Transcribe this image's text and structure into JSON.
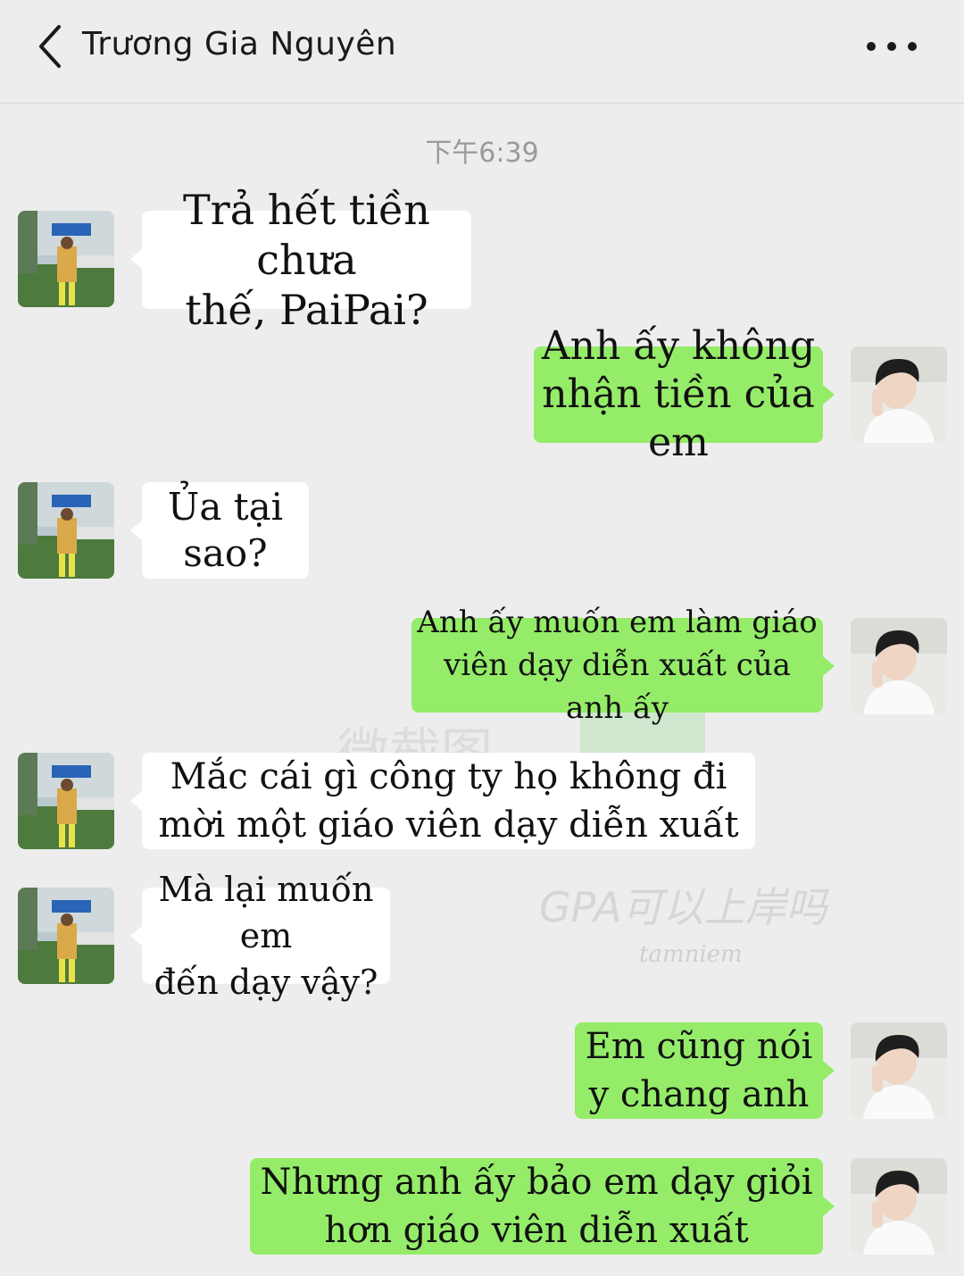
{
  "header": {
    "title": "Trương Gia Nguyên",
    "back_icon": "chevron-left-icon",
    "more_icon": "more-horizontal-icon"
  },
  "timestamp": "下午6:39",
  "messages": [
    {
      "side": "left",
      "lines": [
        "Trả hết tiền chưa",
        "thế, PaiPai?"
      ]
    },
    {
      "side": "right",
      "lines": [
        "Anh ấy không",
        "nhận tiền của em"
      ]
    },
    {
      "side": "left",
      "lines": [
        "Ủa tại sao?"
      ]
    },
    {
      "side": "right",
      "lines": [
        "Anh ấy muốn em làm giáo",
        "viên dạy diễn xuất của anh ấy"
      ]
    },
    {
      "side": "left",
      "lines": [
        "Mắc cái gì công ty họ không đi",
        "mời một giáo viên dạy diễn xuất"
      ]
    },
    {
      "side": "left",
      "lines": [
        "Mà lại muốn em",
        "đến dạy vậy?"
      ]
    },
    {
      "side": "right",
      "lines": [
        "Em cũng nói",
        "y chang anh"
      ]
    },
    {
      "side": "right",
      "lines": [
        "Nhưng anh ấy bảo em dạy giỏi",
        "hơn giáo viên diễn xuất"
      ]
    }
  ],
  "watermarks": {
    "top": "微截图",
    "middle": "GPA可以上岸吗",
    "bottom": "tamniem"
  },
  "colors": {
    "background": "#ededed",
    "bubble_left": "#ffffff",
    "bubble_right": "#95ec69"
  }
}
